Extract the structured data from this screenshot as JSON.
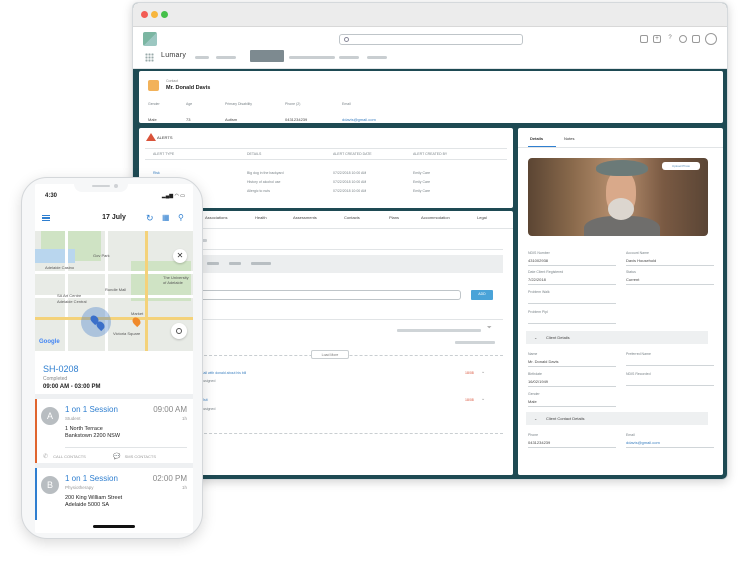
{
  "desktop": {
    "app_name": "Lumary",
    "contact": {
      "kicker": "Contact",
      "name": "Mr. Donald Davis",
      "fields": [
        {
          "label": "Gender",
          "value": "Male"
        },
        {
          "label": "Age",
          "value": "73"
        },
        {
          "label": "Primary Disability",
          "value": "Autism"
        },
        {
          "label": "Phone (2)",
          "value": "0431234239"
        },
        {
          "label": "Email",
          "value": "ddavis@gmail.com"
        }
      ]
    },
    "alerts": {
      "title": "ALERTS",
      "columns": [
        "ALERT TYPE",
        "DETAILS",
        "ALERT CREATED DATE",
        "ALERT CREATED BY"
      ],
      "rows": [
        {
          "type": "Risk",
          "details": "Big dog in the backyard",
          "date": "07/22/2018 10:00 AM",
          "by": "Emily Care"
        },
        {
          "type": "",
          "details": "History of alcohol use",
          "date": "07/22/2018 10:00 AM",
          "by": "Emily Care"
        },
        {
          "type": "",
          "details": "Allergic to nuts",
          "date": "07/22/2018 10:00 AM",
          "by": "Emily Care"
        }
      ]
    },
    "tabs": [
      "Associations",
      "Health",
      "Assessments",
      "Contacts",
      "Plans",
      "Accommodation",
      "Legal"
    ],
    "activity": {
      "add_button": "ADD",
      "load_more": "Load More",
      "items": [
        {
          "text": "Call with donald about his bill",
          "date": "18/08"
        },
        {
          "text": "Visit",
          "date": "18/08"
        }
      ],
      "assigned_1": "Assigned",
      "assigned_2": "Assigned"
    },
    "details": {
      "tab_details": "Details",
      "tab_notes": "Notes",
      "photo_button": "Upload Photo",
      "fields": [
        {
          "label": "NDIS Number",
          "value": "431002938"
        },
        {
          "label": "Account Name",
          "value": "Davis Household"
        },
        {
          "label": "Date Client Registered",
          "value": "7/22/2018"
        },
        {
          "label": "Status",
          "value": "Current"
        },
        {
          "label": "Problem Walk",
          "value": ""
        },
        {
          "label": "Problem Pipl",
          "value": ""
        }
      ],
      "section_client": "Client Details",
      "client_fields": [
        {
          "label": "Name",
          "value": "Mr. Donald Davis"
        },
        {
          "label": "Preferred Name",
          "value": ""
        },
        {
          "label": "Birthdate",
          "value": "16/02/1949"
        },
        {
          "label": "NDIS Recorded",
          "value": ""
        },
        {
          "label": "Gender",
          "value": "Male"
        }
      ],
      "section_contact": "Client Contact Details",
      "contact_fields": [
        {
          "label": "Phone",
          "value": "0431234239"
        },
        {
          "label": "Email",
          "value": "ddavis@gmail.com"
        }
      ]
    }
  },
  "phone": {
    "status_time": "4:30",
    "date": "17 July",
    "map": {
      "labels": [
        "Adelaide Casino",
        "Gov Park",
        "Rundle Mall",
        "The University of Adelaide",
        "SA Art Centre",
        "Adelaide Central",
        "Market",
        "Victoria Square"
      ],
      "google": "Google"
    },
    "shift": {
      "code": "SH-0208",
      "status": "Completed",
      "time": "09:00 AM - 03:00 PM"
    },
    "sessions": [
      {
        "badge": "A",
        "title": "1 on 1 Session",
        "time": "09:00 AM",
        "type": "Student",
        "duration": "1h",
        "address_1": "1 North Terrace",
        "address_2": "Bankstown 2200 NSW",
        "call": "CALL CONTACTS",
        "sms": "SMS CONTACTS",
        "stripe": "#e0652f"
      },
      {
        "badge": "B",
        "title": "1 on 1 Session",
        "time": "02:00 PM",
        "type": "Physiotherapy",
        "duration": "1h",
        "address_1": "200 King William Street",
        "address_2": "Adelaide 5000 SA",
        "stripe": "#2f7fd0"
      }
    ]
  }
}
